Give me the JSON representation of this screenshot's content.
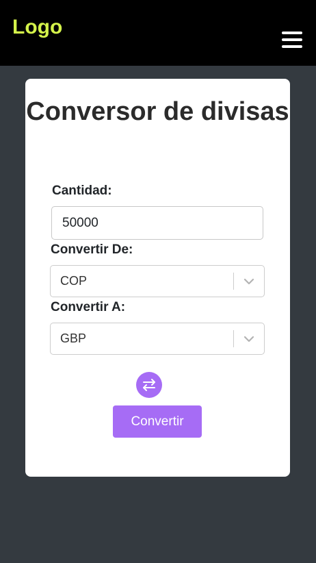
{
  "navbar": {
    "logo": "Logo",
    "logo_color": "#d4f24a",
    "menu_icon": "hamburger-menu-icon"
  },
  "converter": {
    "title": "Conversor de divisas",
    "amount_label": "Cantidad:",
    "amount_value": "50000",
    "from_label": "Convertir De:",
    "from_value": "COP",
    "to_label": "Convertir A:",
    "to_value": "GBP",
    "swap_icon": "swap-arrows-icon",
    "convert_button": "Convertir"
  },
  "colors": {
    "page_bg": "#343a40",
    "navbar_bg": "#000000",
    "accent": "#a66cf5",
    "card_bg": "#ffffff"
  }
}
